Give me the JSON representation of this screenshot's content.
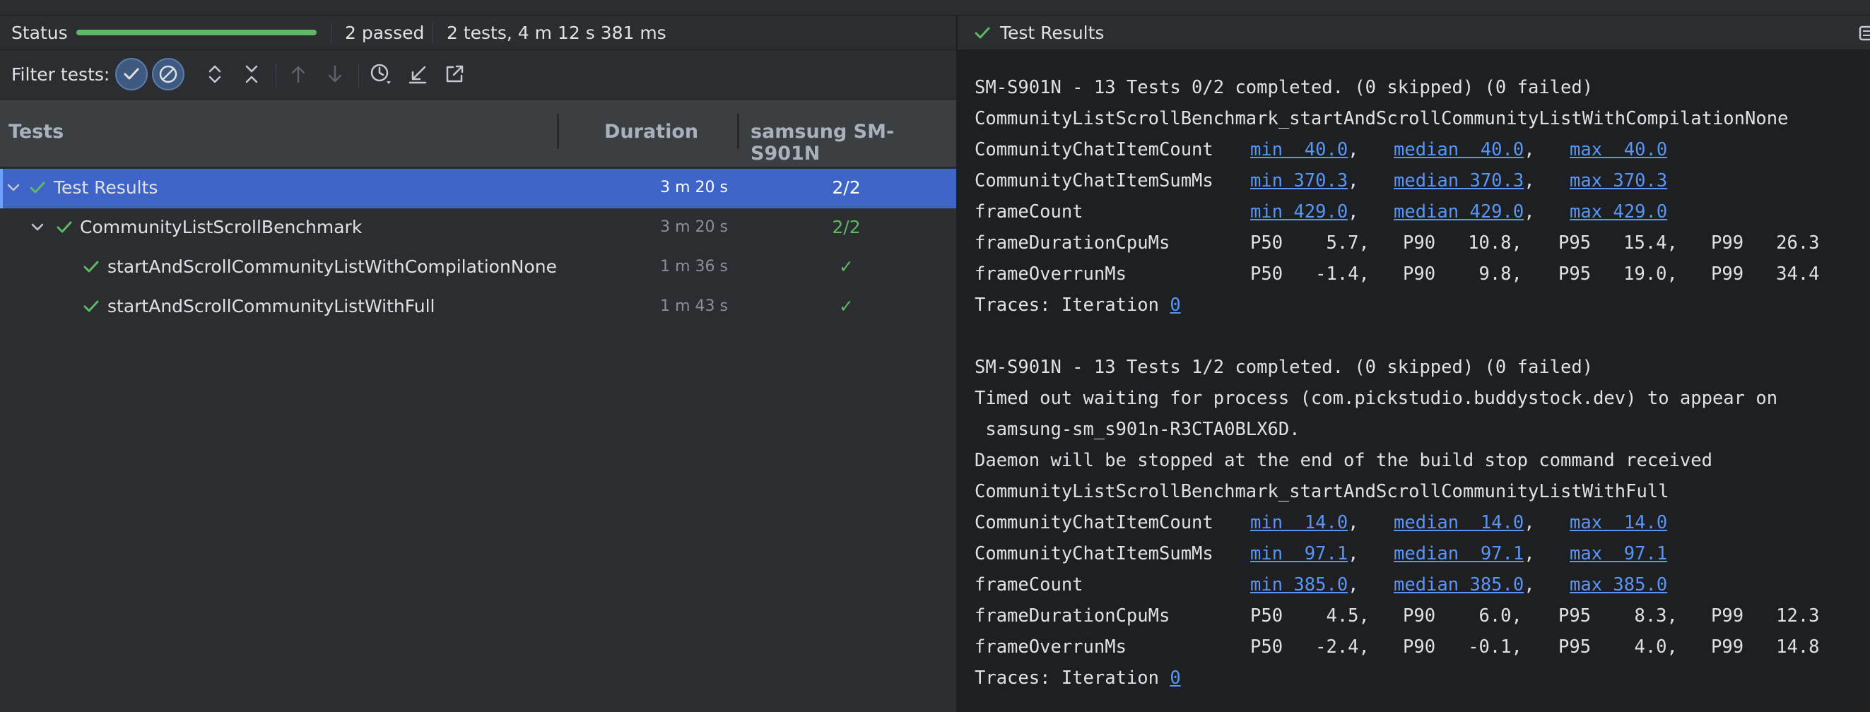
{
  "status": {
    "label": "Status",
    "progress": 1.0,
    "passed": "2 passed",
    "summary": "2 tests, 4 m 12 s 381 ms"
  },
  "filter": {
    "label": "Filter tests:"
  },
  "table": {
    "headers": {
      "tests": "Tests",
      "duration": "Duration",
      "device": "samsung SM-S901N"
    },
    "rows": [
      {
        "name": "Test Results",
        "duration": "3 m 20 s",
        "result": "2/2"
      },
      {
        "name": "CommunityListScrollBenchmark",
        "duration": "3 m 20 s",
        "result": "2/2"
      },
      {
        "name": "startAndScrollCommunityListWithCompilationNone",
        "duration": "1 m 36 s",
        "result": "✓"
      },
      {
        "name": "startAndScrollCommunityListWithFull",
        "duration": "1 m 43 s",
        "result": "✓"
      }
    ]
  },
  "right": {
    "title": "Test Results"
  },
  "console": {
    "line1": "SM-S901N - 13 Tests 0/2 completed. (0 skipped) (0 failed)",
    "line2": "CommunityListScrollBenchmark_startAndScrollCommunityListWithCompilationNone",
    "m1": [
      {
        "label": "CommunityChatItemCount",
        "min": "min  40.0",
        "median": "median  40.0",
        "max": "max  40.0"
      },
      {
        "label": "CommunityChatItemSumMs",
        "min": "min 370.3",
        "median": "median 370.3",
        "max": "max 370.3"
      },
      {
        "label": "frameCount",
        "min": "min 429.0",
        "median": "median 429.0",
        "max": "max 429.0"
      }
    ],
    "p1": [
      {
        "label": "frameDurationCpuMs",
        "p50": "P50    5.7,",
        "p90": "P90   10.8,",
        "p95": "P95   15.4,",
        "p99": "P99   26.3"
      },
      {
        "label": "frameOverrunMs",
        "p50": "P50   -1.4,",
        "p90": "P90    9.8,",
        "p95": "P95   19.0,",
        "p99": "P99   34.4"
      }
    ],
    "traces1": "Traces: Iteration ",
    "traces1_link": "0",
    "line3": "SM-S901N - 13 Tests 1/2 completed. (0 skipped) (0 failed)",
    "line4": "Timed out waiting for process (com.pickstudio.buddystock.dev) to appear on",
    "line5": " samsung-sm_s901n-R3CTA0BLX6D.",
    "line6": "Daemon will be stopped at the end of the build stop command received",
    "line7": "CommunityListScrollBenchmark_startAndScrollCommunityListWithFull",
    "m2": [
      {
        "label": "CommunityChatItemCount",
        "min": "min  14.0",
        "median": "median  14.0",
        "max": "max  14.0"
      },
      {
        "label": "CommunityChatItemSumMs",
        "min": "min  97.1",
        "median": "median  97.1",
        "max": "max  97.1"
      },
      {
        "label": "frameCount",
        "min": "min 385.0",
        "median": "median 385.0",
        "max": "max 385.0"
      }
    ],
    "p2": [
      {
        "label": "frameDurationCpuMs",
        "p50": "P50    4.5,",
        "p90": "P90    6.0,",
        "p95": "P95    8.3,",
        "p99": "P99   12.3"
      },
      {
        "label": "frameOverrunMs",
        "p50": "P50   -2.4,",
        "p90": "P90   -0.1,",
        "p95": "P95    4.0,",
        "p99": "P99   14.8"
      }
    ],
    "traces2": "Traces: Iteration ",
    "traces2_link": "0"
  },
  "colors": {
    "success": "#5fb865",
    "selection": "#3e64c8",
    "link": "#5895f5"
  }
}
